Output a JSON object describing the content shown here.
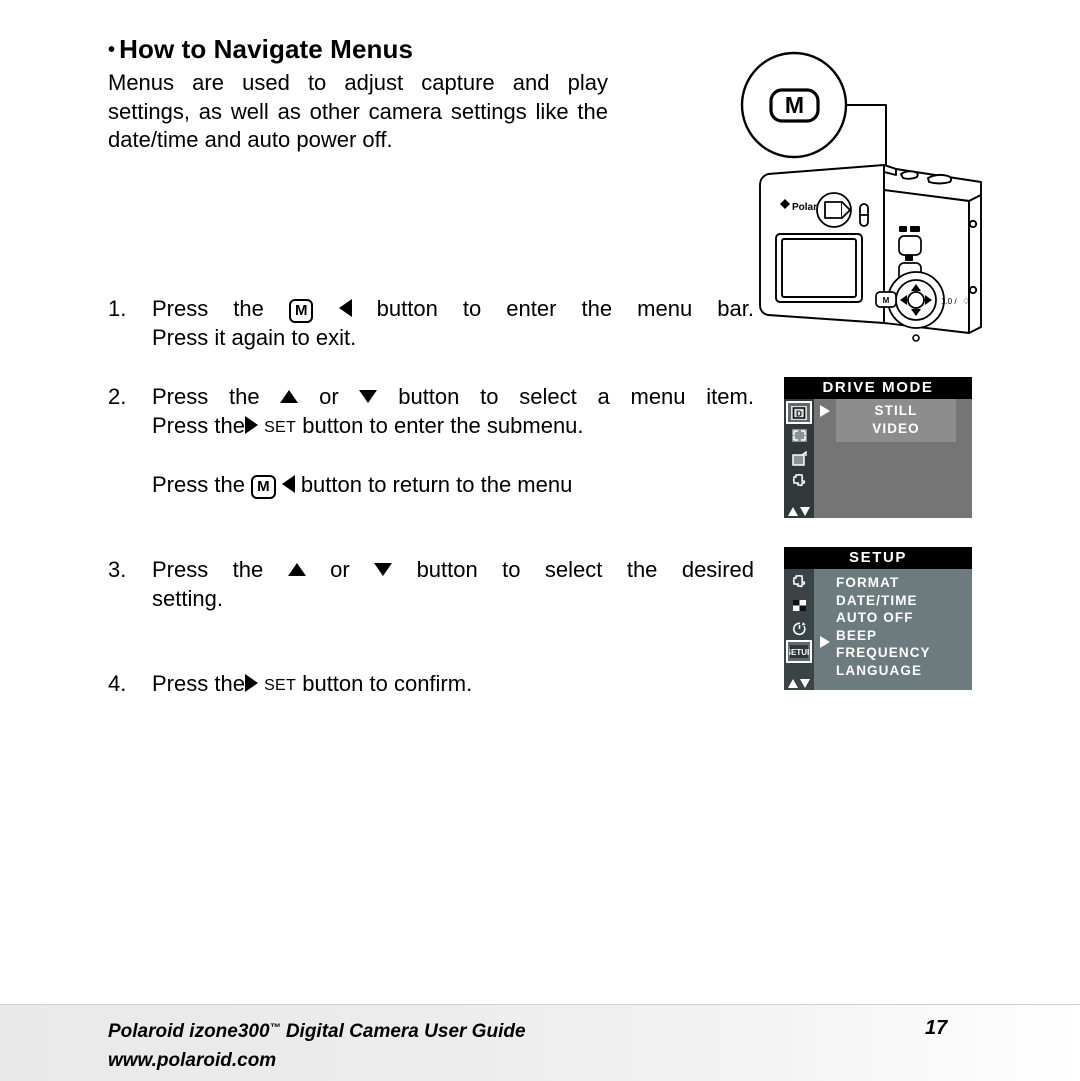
{
  "heading": {
    "bullet": "•",
    "text": "How to Navigate Menus"
  },
  "intro": "Menus are used to adjust capture and play settings, as well as other camera settings like the date/time and auto power off.",
  "steps": [
    {
      "number": "1.",
      "line1_a": "Press the",
      "icons": [
        "m-button-icon",
        "left-arrow-icon"
      ],
      "line1_b": "button to enter the menu bar.",
      "line2": "Press it again to exit."
    },
    {
      "number": "2.",
      "line1_a": "Press the",
      "line1_b": "or",
      "line1_c": "button to select a menu item.",
      "line2_a": "Press the",
      "line2_set": "SET",
      "line2_b": "button to enter the submenu.",
      "line3_a": "Press the",
      "line3_b": "button to return to the menu"
    },
    {
      "number": "3.",
      "line1_a": "Press the",
      "line1_b": "or",
      "line1_c": "button to select the desired",
      "line2": "setting."
    },
    {
      "number": "4.",
      "line1_a": "Press the",
      "line1_set": "SET",
      "line1_b": "button to confirm."
    }
  ],
  "callout": {
    "button_label": "M"
  },
  "camera": {
    "brand_label": "Polaroid"
  },
  "drive_menu": {
    "title": "DRIVE MODE",
    "options": [
      "STILL",
      "VIDEO"
    ],
    "rail_icons": [
      "drive-mode-icon",
      "resolution-icon",
      "quality-icon",
      "setup-icon"
    ],
    "selected_rail_index": 0,
    "cursor_option_index": 0,
    "colors": {
      "title_bar": "#000000",
      "rail": "#31383a",
      "panel": "#757575",
      "option_box": "#8d8d8d",
      "text": "#ffffff"
    }
  },
  "setup_menu": {
    "title": "SETUP",
    "options": [
      "FORMAT",
      "DATE/TIME",
      "AUTO OFF",
      "BEEP",
      "FREQUENCY",
      "LANGUAGE"
    ],
    "rail_icons": [
      "setup-icon",
      "checkerboard-icon",
      "timer-icon",
      "setup-selected-icon"
    ],
    "selected_rail_index": 3,
    "cursor_option_index": 4,
    "colors": {
      "title_bar": "#000000",
      "rail": "#3a4446",
      "panel": "#6b7b7e",
      "text": "#ffffff"
    }
  },
  "footer": {
    "line1_a": "Polaroid izone300",
    "tm": "™",
    "line1_b": " Digital Camera User Guide",
    "line2": "www.polaroid.com",
    "page_number": "17"
  }
}
